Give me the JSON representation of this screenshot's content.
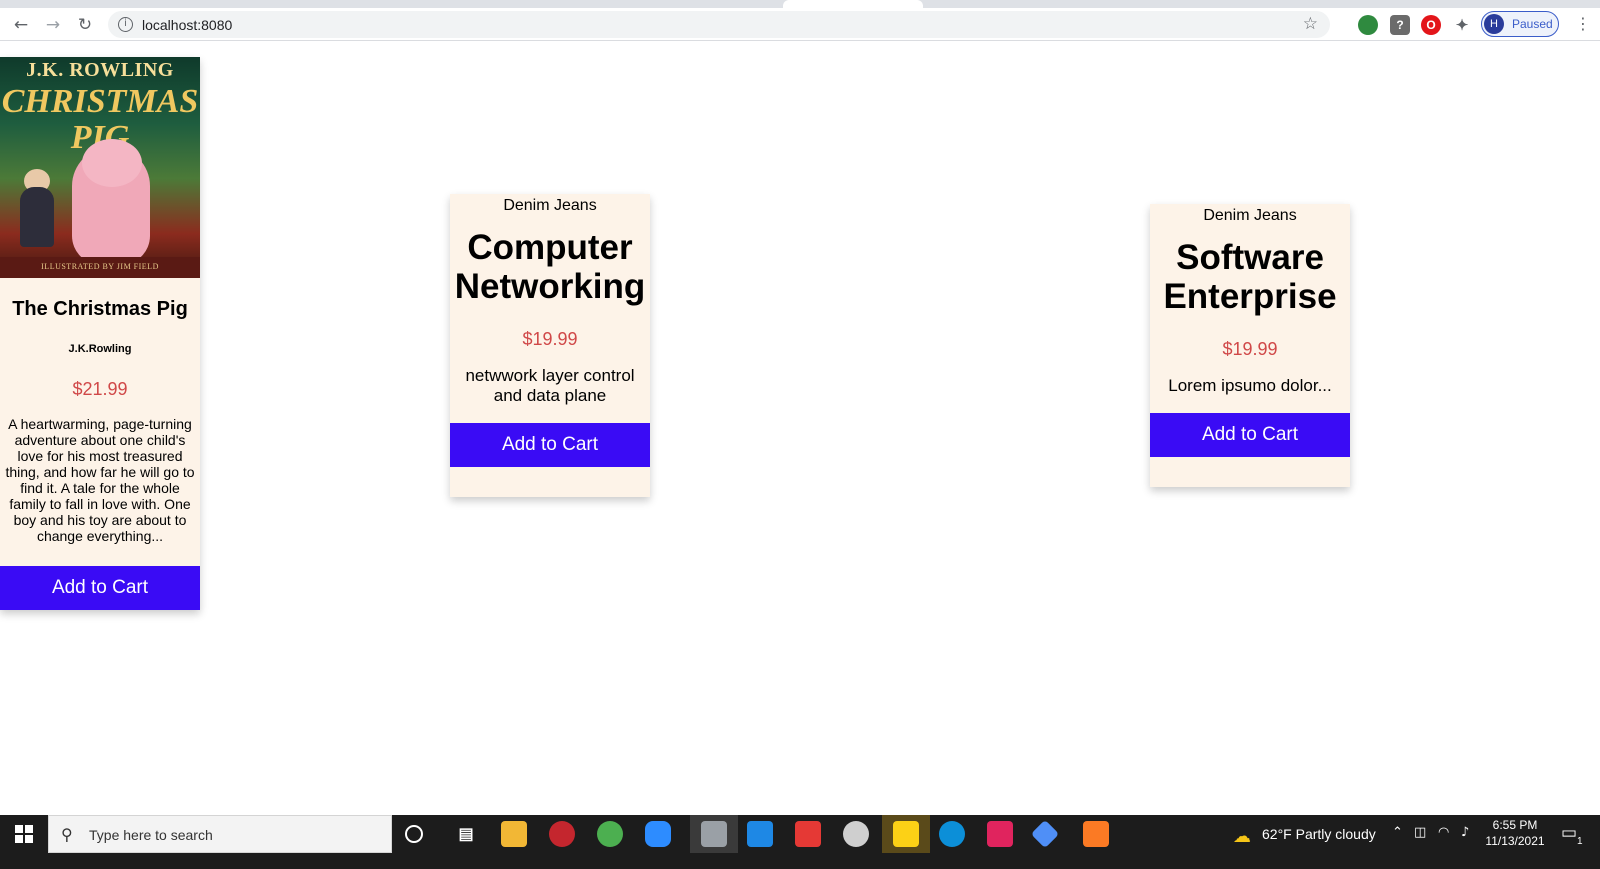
{
  "browser": {
    "url": "localhost:8080",
    "profile_initial": "H",
    "profile_status": "Paused"
  },
  "products": [
    {
      "image_alt": "The Christmas Pig",
      "cover_author": "J.K. ROWLING",
      "cover_title_1": "CHRISTMAS",
      "cover_title_2": "PIG",
      "cover_illustrator": "ILLUSTRATED BY JIM FIELD",
      "title": "The Christmas Pig",
      "author": "J.K.Rowling",
      "price": "$21.99",
      "description": "A heartwarming, page-turning adventure about one child's love for his most treasured thing, and how far he will go to find it. A tale for the whole family to fall in love with. One boy and his toy are about to change everything...",
      "button_label": "Add to Cart"
    },
    {
      "image_alt": "Denim Jeans",
      "title": "Computer Networking",
      "price": "$19.99",
      "description": "netwwork layer control and data plane",
      "button_label": "Add to Cart"
    },
    {
      "image_alt": "Denim Jeans",
      "title": "Software Enterprise",
      "price": "$19.99",
      "description": "Lorem ipsumo dolor...",
      "button_label": "Add to Cart"
    }
  ],
  "colors": {
    "card_bg": "#fdf3e8",
    "button_bg": "#3a0bf5",
    "price": "#d04848"
  },
  "taskbar": {
    "search_placeholder": "Type here to search",
    "weather": "62°F  Partly cloudy",
    "time": "6:55 PM",
    "date": "11/13/2021",
    "notification_count": "1"
  }
}
